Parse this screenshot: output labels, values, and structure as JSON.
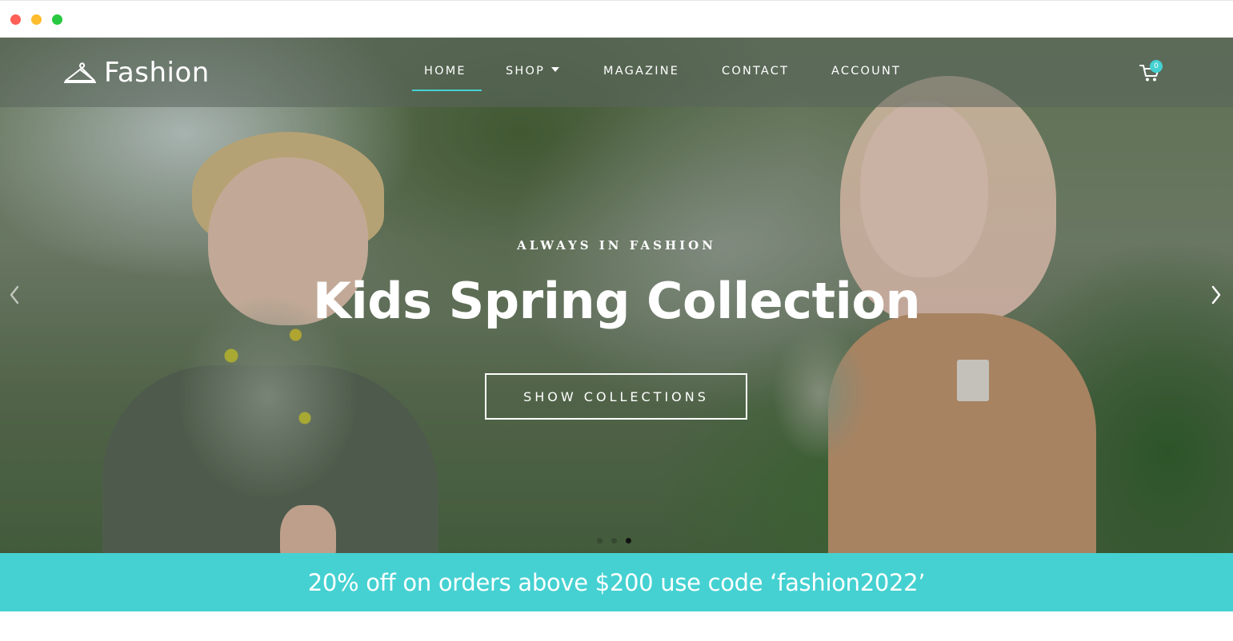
{
  "window": {
    "controls": [
      "close",
      "minimize",
      "maximize"
    ]
  },
  "brand": {
    "name": "Fashion",
    "icon": "hanger-icon"
  },
  "nav": {
    "items": [
      {
        "label": "HOME",
        "active": true
      },
      {
        "label": "SHOP",
        "has_dropdown": true
      },
      {
        "label": "MAGAZINE"
      },
      {
        "label": "CONTACT"
      },
      {
        "label": "ACCOUNT"
      }
    ],
    "cart": {
      "icon": "cart-icon",
      "count": "0"
    }
  },
  "hero": {
    "kicker": "ALWAYS IN FASHION",
    "title": "Kids Spring Collection",
    "cta_label": "SHOW COLLECTIONS",
    "prev_icon": "chevron-left-icon",
    "next_icon": "chevron-right-icon",
    "slides_total": 3,
    "active_slide": 3
  },
  "promo": {
    "text": "20% off on orders above $200 use code ‘fashion2022’"
  },
  "colors": {
    "accent": "#45d1d2",
    "text_light": "#ffffff"
  }
}
